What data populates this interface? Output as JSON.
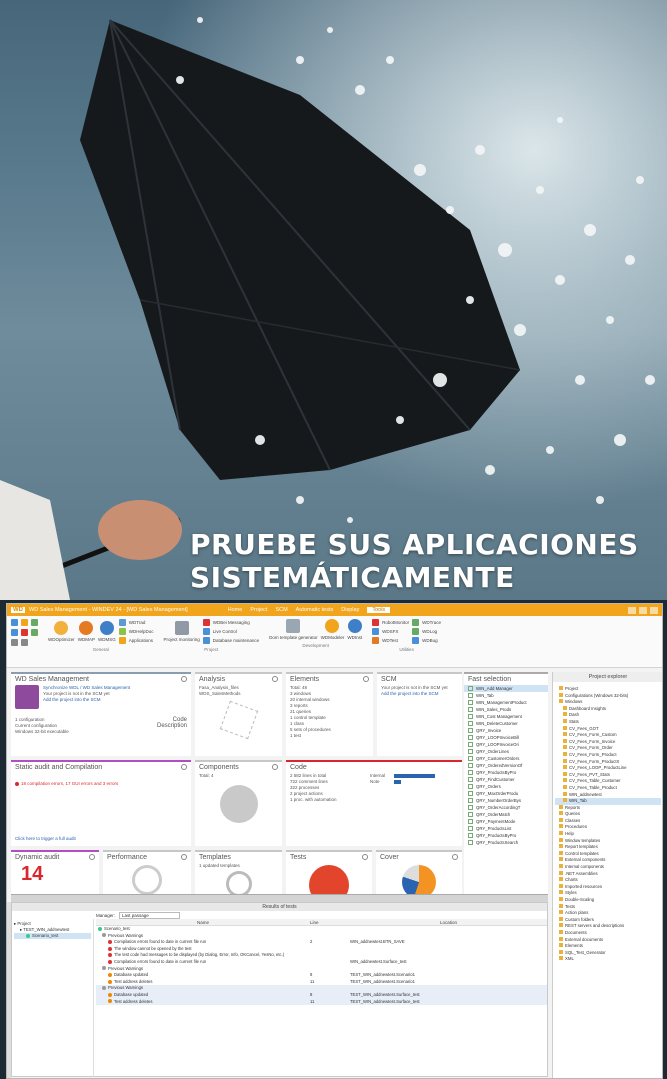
{
  "headline": {
    "line1": "PRUEBE SUS APLICACIONES",
    "line2": "SISTEMÁTICAMENTE"
  },
  "window": {
    "logo": "WD",
    "title": "WD Sales Management - WINDEV 24 - [WD Sales Management]",
    "menu_tabs": [
      "Home",
      "Project",
      "SCM",
      "Automatic tests",
      "Display",
      "Tools"
    ],
    "active_tab": "Tools"
  },
  "ribbon": {
    "groups": [
      {
        "name": "General",
        "items": [
          "WDOptimizer",
          "WDMAP",
          "WDMSG",
          "WDTrad",
          "WDHelpDoc",
          "Applications"
        ]
      },
      {
        "name": "Project",
        "items": [
          "Project monitoring",
          "WDBei Messaging",
          "Live Control",
          "Database maintenance"
        ]
      },
      {
        "name": "Development",
        "items": [
          "Dom template generator",
          "WDModeler",
          "WDInst"
        ]
      },
      {
        "name": "Utilities",
        "items": [
          "RobotMonitor",
          "WDSFX",
          "WDTest",
          "WDTrace",
          "WDLog",
          "WDBug"
        ]
      }
    ]
  },
  "tiles": {
    "project": {
      "title": "WD Sales Management",
      "link1": "Synchronize WDL / WD Sales Management",
      "note": "Your project is not in the SCM yet",
      "link2": "Add the project into the SCM",
      "config": "1 configuration",
      "config_sub": "Current configuration",
      "platform": "Windows 32-bit executable",
      "code_label": "Code",
      "desc_label": "Description"
    },
    "analysis": {
      "title": "Analysis",
      "line1": "Fasa_Analysis_files",
      "line2": "WDS_SalesMethods"
    },
    "elements": {
      "title": "Elements",
      "lines": [
        "Total: 48",
        "3 windows",
        "20 internal windows",
        "3 reports",
        "21 queries",
        "1 control template",
        "1 class",
        "5 sets of procedures",
        "1 test"
      ]
    },
    "scm": {
      "title": "SCM",
      "note": "Your project is not in the SCM yet",
      "link": "Add the project into the SCM"
    },
    "audit": {
      "title": "Static audit and Compilation",
      "error": "18 compilation errors, 17 GUI errors and 3 errors",
      "link": "Click here to trigger a full audit"
    },
    "components": {
      "title": "Components",
      "sub": "Total: 4"
    },
    "code": {
      "title": "Code",
      "lines": [
        "2 582 lines in total",
        "722 comment lines",
        "322 processes",
        "2 project actions",
        "1 proc. with automation"
      ],
      "bar1_label": "Internal",
      "bar2_label": "Note",
      "bar1_value": 0.9,
      "bar2_value": 0.15
    },
    "dynamic": {
      "title": "Dynamic audit",
      "value": "14"
    },
    "performance": {
      "title": "Performance"
    },
    "templates": {
      "title": "Templates",
      "sub": "1 updated templates"
    },
    "tests": {
      "title": "Tests"
    },
    "cover": {
      "title": "Cover"
    }
  },
  "fast_selection": {
    "title": "Fast selection",
    "items": [
      "WIN_Add Manager",
      "WIN_Tab",
      "WIN_ManagementProduct",
      "WIN_Sales_Prods",
      "WIN_Cost Management",
      "WIN_DeleteCustomer",
      "QRY_Invoice",
      "QRY_LOOPInvoiceBill",
      "QRY_LOOPInvoiceOri",
      "QRY_OrderLines",
      "QRY_CustomerOrders",
      "QRY_OrderedVersionOf",
      "QRY_ProductsByPro",
      "QRY_FindCustomer",
      "QRY_Orders",
      "QRY_MaxOrderProdu",
      "QRY_NumberOrderBys",
      "QRY_OrderAccordingT",
      "QRY_OrderMatch",
      "QRY_PaymentMode",
      "QRY_ProductsList",
      "QRY_ProductsByPro",
      "QRY_ProductsSearch"
    ]
  },
  "explorer": {
    "title": "Project explorer",
    "items": [
      "Project",
      "Configurations (Windows 32-bits)",
      "Windows",
      "Dashboard Insights",
      "Dash",
      "Stats",
      "CV_Fees_GOT",
      "CV_Fees_Form_Custom",
      "CV_Fees_Form_Invoice",
      "CV_Fees_Form_Order",
      "CV_Fees_Form_Product",
      "CV_Fees_Form_ProductX",
      "CV_Fees_LOOP_ProductLine",
      "CV_Fees_PVT_Stats",
      "CV_Fees_Table_Customer",
      "CV_Fees_Table_Product",
      "WIN_addnewtest",
      "WIN_Tab",
      "Reports",
      "Queries",
      "Classes",
      "Procedures",
      "Help",
      "Window templates",
      "Report templates",
      "Control templates",
      "External components",
      "Internal components",
      ".NET Assemblies",
      "Charts",
      "Imported resources",
      "Styles",
      "Double-Scaling",
      "Tests",
      "Action plans",
      "Custom folders",
      "REST servers and descriptions",
      "Documents",
      "External documents",
      "Elements",
      "SQL_Test_Generator",
      "XML"
    ]
  },
  "results": {
    "title": "Results of tests",
    "manager_label": "Manager:",
    "manager_value": "Last passage",
    "tree": [
      "Project",
      "TEST_WIN_addnewtest",
      "Scenario_test"
    ],
    "col_name": "Name",
    "col_line": "Line",
    "col_location": "Location",
    "rows": [
      {
        "name": "Scenario_test",
        "line": "",
        "location": "",
        "color": "#3c8"
      },
      {
        "name": "Previous Warnings",
        "line": "",
        "location": "",
        "color": "#999"
      },
      {
        "name": "Compilation errors found to date in current file run",
        "line": "2",
        "location": "WIN_addnewtest.BTN_SAVE",
        "color": "#d33"
      },
      {
        "name": "The window cannot be opened by the test",
        "line": "",
        "location": "",
        "color": "#d33"
      },
      {
        "name": "The test code had messages to be displayed (by Dialog, Error, Info, OKCancel, YesNo, etc.)",
        "line": "",
        "location": "",
        "color": "#d33"
      },
      {
        "name": "Compilation errors found to date in current file run",
        "line": "",
        "location": "WIN_addnewtest.Surface_test",
        "color": "#d33"
      },
      {
        "name": "Previous Warnings",
        "line": "",
        "location": "",
        "color": "#999"
      },
      {
        "name": "Database updated",
        "line": "8",
        "location": "TEST_WIN_addnewtest.Scenario1",
        "color": "#e80"
      },
      {
        "name": "Test address deletes",
        "line": "11",
        "location": "TEST_WIN_addnewtest.Scenario1",
        "color": "#e80"
      },
      {
        "name": "Previous Warnings",
        "line": "",
        "location": "",
        "color": "#999"
      },
      {
        "name": "Database updated",
        "line": "8",
        "location": "TEST_WIN_addnewtest.Surface_test",
        "color": "#e80"
      },
      {
        "name": "Test address deletes",
        "line": "11",
        "location": "TEST_WIN_addnewtest.Surface_test",
        "color": "#e80"
      }
    ]
  },
  "colors": {
    "accent": "#f0a51d",
    "link": "#2a63b0",
    "error": "#d8282d",
    "test_red": "#e2452c",
    "cover_orange": "#f39323"
  }
}
